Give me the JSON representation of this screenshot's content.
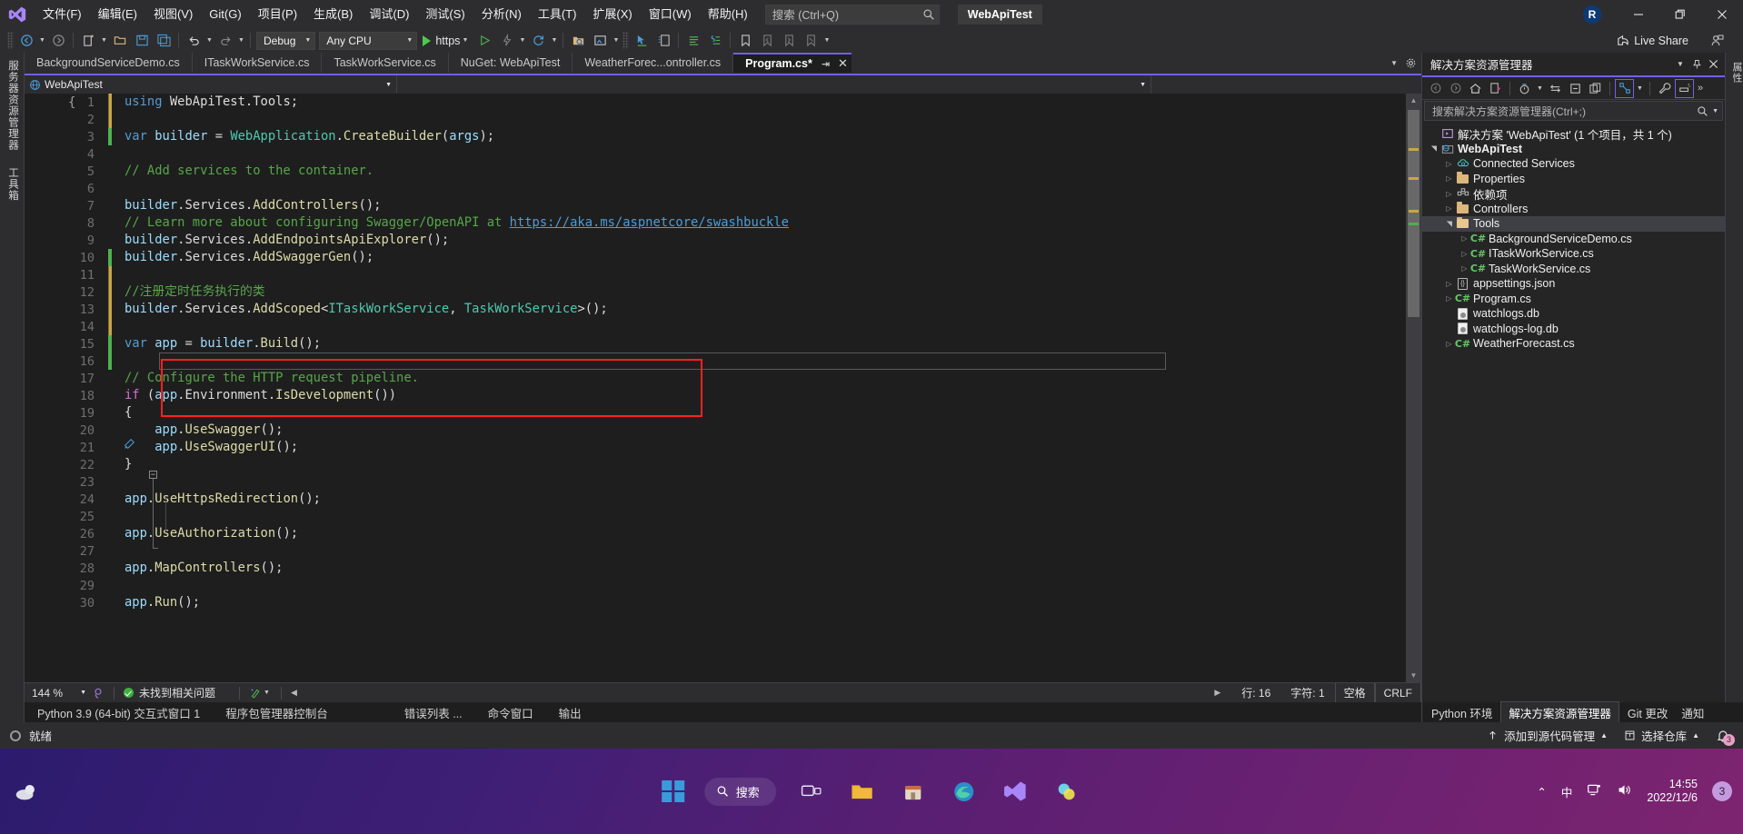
{
  "window": {
    "project_chip": "WebApiTest",
    "account_initial": "R",
    "minimize": "—",
    "maximize": "❐",
    "close": "✕"
  },
  "menu": {
    "items": [
      {
        "label": "文件(F)",
        "name": "menu-file"
      },
      {
        "label": "编辑(E)",
        "name": "menu-edit"
      },
      {
        "label": "视图(V)",
        "name": "menu-view"
      },
      {
        "label": "Git(G)",
        "name": "menu-git"
      },
      {
        "label": "项目(P)",
        "name": "menu-project"
      },
      {
        "label": "生成(B)",
        "name": "menu-build"
      },
      {
        "label": "调试(D)",
        "name": "menu-debug"
      },
      {
        "label": "测试(S)",
        "name": "menu-test"
      },
      {
        "label": "分析(N)",
        "name": "menu-analyze"
      },
      {
        "label": "工具(T)",
        "name": "menu-tools"
      },
      {
        "label": "扩展(X)",
        "name": "menu-extensions"
      },
      {
        "label": "窗口(W)",
        "name": "menu-window"
      },
      {
        "label": "帮助(H)",
        "name": "menu-help"
      }
    ],
    "search_placeholder": "搜索 (Ctrl+Q)"
  },
  "toolbar": {
    "configuration": "Debug",
    "platform": "Any CPU",
    "run_target": "https",
    "live_share": "Live Share"
  },
  "editor": {
    "tabs": [
      {
        "label": "BackgroundServiceDemo.cs",
        "active": false
      },
      {
        "label": "ITaskWorkService.cs",
        "active": false
      },
      {
        "label": "TaskWorkService.cs",
        "active": false
      },
      {
        "label": "NuGet: WebApiTest",
        "active": false
      },
      {
        "label": "WeatherForec...ontroller.cs",
        "active": false
      },
      {
        "label": "Program.cs*",
        "active": true
      }
    ],
    "nav_left": "WebApiTest",
    "nav_right": "",
    "lines": [
      {
        "n": 1,
        "bar": "yellow",
        "html": "<span class=\"kw\">using</span> WebApiTest.<span class=\"pl\">Tools</span>;"
      },
      {
        "n": 2,
        "bar": "yellow",
        "html": ""
      },
      {
        "n": 3,
        "bar": "green",
        "html": "<span class=\"kw\">var</span> <span class=\"par\">builder</span> = <span class=\"ty\">WebApplication</span>.<span class=\"fn\">CreateBuilder</span>(<span class=\"par\">args</span>);"
      },
      {
        "n": 4,
        "bar": "none",
        "html": ""
      },
      {
        "n": 5,
        "bar": "none",
        "html": "<span class=\"cm\">// Add services to the container.</span>"
      },
      {
        "n": 6,
        "bar": "none",
        "html": ""
      },
      {
        "n": 7,
        "bar": "none",
        "html": "<span class=\"par\">builder</span>.<span class=\"pl\">Services</span>.<span class=\"fn\">AddControllers</span>();"
      },
      {
        "n": 8,
        "bar": "none",
        "html": "<span class=\"cm\">// Learn more about configuring Swagger/OpenAPI at </span><span class=\"lnk\">https://aka.ms/aspnetcore/swashbuckle</span>"
      },
      {
        "n": 9,
        "bar": "none",
        "html": "<span class=\"par\">builder</span>.<span class=\"pl\">Services</span>.<span class=\"fn\">AddEndpointsApiExplorer</span>();"
      },
      {
        "n": 10,
        "bar": "green",
        "html": "<span class=\"par\">builder</span>.<span class=\"pl\">Services</span>.<span class=\"fn\">AddSwaggerGen</span>();"
      },
      {
        "n": 11,
        "bar": "yellow",
        "html": ""
      },
      {
        "n": 12,
        "bar": "yellow",
        "html": "<span class=\"cm\">//注册定时任务执行的类</span>"
      },
      {
        "n": 13,
        "bar": "yellow",
        "html": "<span class=\"par\">builder</span>.<span class=\"pl\">Services</span>.<span class=\"fn\">AddScoped</span>&lt;<span class=\"ty\">ITaskWorkService</span>, <span class=\"ty\">TaskWorkService</span>&gt;();"
      },
      {
        "n": 14,
        "bar": "yellow",
        "html": ""
      },
      {
        "n": 15,
        "bar": "green",
        "html": "<span class=\"kw\">var</span> <span class=\"par\">app</span> = <span class=\"par\">builder</span>.<span class=\"fn\">Build</span>();"
      },
      {
        "n": 16,
        "bar": "green",
        "html": "",
        "current": true
      },
      {
        "n": 17,
        "bar": "none",
        "html": "<span class=\"cm\">// Configure the HTTP request pipeline.</span>"
      },
      {
        "n": 18,
        "bar": "none",
        "html": "<span class=\"kw2\">if</span> (<span class=\"par\">app</span>.<span class=\"pl\">Environment</span>.<span class=\"fn\">IsDevelopment</span>())"
      },
      {
        "n": 19,
        "bar": "none",
        "html": "{"
      },
      {
        "n": 20,
        "bar": "none",
        "html": "    <span class=\"par\">app</span>.<span class=\"fn\">UseSwagger</span>();"
      },
      {
        "n": 21,
        "bar": "none",
        "html": "    <span class=\"par\">app</span>.<span class=\"fn\">UseSwaggerUI</span>();"
      },
      {
        "n": 22,
        "bar": "none",
        "html": "}"
      },
      {
        "n": 23,
        "bar": "none",
        "html": ""
      },
      {
        "n": 24,
        "bar": "none",
        "html": "<span class=\"par\">app</span>.<span class=\"fn\">UseHttpsRedirection</span>();"
      },
      {
        "n": 25,
        "bar": "none",
        "html": ""
      },
      {
        "n": 26,
        "bar": "none",
        "html": "<span class=\"par\">app</span>.<span class=\"fn\">UseAuthorization</span>();"
      },
      {
        "n": 27,
        "bar": "none",
        "html": ""
      },
      {
        "n": 28,
        "bar": "none",
        "html": "<span class=\"par\">app</span>.<span class=\"fn\">MapControllers</span>();"
      },
      {
        "n": 29,
        "bar": "none",
        "html": ""
      },
      {
        "n": 30,
        "bar": "none",
        "html": "<span class=\"par\">app</span>.<span class=\"fn\">Run</span>();"
      }
    ],
    "highlight_color": "#ff2020",
    "status": {
      "zoom": "144 %",
      "issues": "未找到相关问题",
      "line": "行: 16",
      "column": "字符: 1",
      "spaces": "空格",
      "eol": "CRLF"
    },
    "bottom_tabs": [
      "Python 3.9 (64-bit) 交互式窗口 1",
      "程序包管理器控制台",
      "错误列表 ...",
      "命令窗口",
      "输出"
    ]
  },
  "left_dock": {
    "tabs": [
      "服务器资源管理器",
      "工具箱"
    ]
  },
  "solution_explorer": {
    "title": "解决方案资源管理器",
    "search_placeholder": "搜索解决方案资源管理器(Ctrl+;)",
    "solution_label": "解决方案 'WebApiTest' (1 个项目，共 1 个)",
    "tree": [
      {
        "label": "WebApiTest",
        "depth": 1,
        "icon": "project-icon",
        "twisty": "down",
        "bold": true,
        "selected": false
      },
      {
        "label": "Connected Services",
        "depth": 2,
        "icon": "connected-services-icon",
        "twisty": "right",
        "bold": false,
        "selected": false
      },
      {
        "label": "Properties",
        "depth": 2,
        "icon": "properties-icon",
        "twisty": "right",
        "bold": false,
        "selected": false
      },
      {
        "label": "依赖项",
        "depth": 2,
        "icon": "dependencies-icon",
        "twisty": "right",
        "bold": false,
        "selected": false
      },
      {
        "label": "Controllers",
        "depth": 2,
        "icon": "folder-icon",
        "twisty": "right",
        "bold": false,
        "selected": false
      },
      {
        "label": "Tools",
        "depth": 2,
        "icon": "folder-open-icon",
        "twisty": "down",
        "bold": false,
        "selected": true
      },
      {
        "label": "BackgroundServiceDemo.cs",
        "depth": 3,
        "icon": "csharp-icon",
        "twisty": "right",
        "bold": false,
        "selected": false
      },
      {
        "label": "ITaskWorkService.cs",
        "depth": 3,
        "icon": "csharp-icon",
        "twisty": "right",
        "bold": false,
        "selected": false
      },
      {
        "label": "TaskWorkService.cs",
        "depth": 3,
        "icon": "csharp-icon",
        "twisty": "right",
        "bold": false,
        "selected": false
      },
      {
        "label": "appsettings.json",
        "depth": 2,
        "icon": "json-icon",
        "twisty": "right",
        "bold": false,
        "selected": false
      },
      {
        "label": "Program.cs",
        "depth": 2,
        "icon": "csharp-icon",
        "twisty": "right",
        "bold": false,
        "selected": false
      },
      {
        "label": "watchlogs.db",
        "depth": 2,
        "icon": "db-icon",
        "twisty": "none",
        "bold": false,
        "selected": false
      },
      {
        "label": "watchlogs-log.db",
        "depth": 2,
        "icon": "db-icon",
        "twisty": "none",
        "bold": false,
        "selected": false
      },
      {
        "label": "WeatherForecast.cs",
        "depth": 2,
        "icon": "csharp-icon",
        "twisty": "right",
        "bold": false,
        "selected": false
      }
    ]
  },
  "right_dock": {
    "tabs": [
      "属性"
    ]
  },
  "bottom_dock_tabs": [
    "Python 环境",
    "解决方案资源管理器",
    "Git 更改",
    "通知"
  ],
  "statusbar": {
    "ready": "就绪",
    "source_control": "添加到源代码管理",
    "repository": "选择仓库",
    "notification_count": "3"
  },
  "taskbar": {
    "search": "搜索",
    "ime": "中",
    "time": "14:55",
    "date": "2022/12/6",
    "tray_badge": "3"
  }
}
